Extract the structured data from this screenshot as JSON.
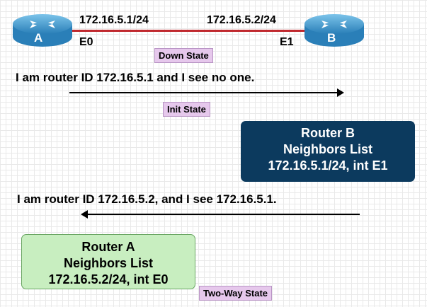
{
  "topology": {
    "router_a": {
      "label": "A",
      "ip": "172.16.5.1/24",
      "interface": "E0"
    },
    "router_b": {
      "label": "B",
      "ip": "172.16.5.2/24",
      "interface": "E1"
    },
    "link_color": "#c0282e"
  },
  "states": {
    "down": "Down State",
    "init": "Init State",
    "two_way": "Two-Way State"
  },
  "messages": {
    "hello_a": "I am router ID 172.16.5.1 and I see  no one.",
    "hello_b": "I am router ID 172.16.5.2, and I see 172.16.5.1."
  },
  "neighbor_lists": {
    "router_b": {
      "title": "Router B",
      "subtitle": "Neighbors List",
      "entry": "172.16.5.1/24, int E1"
    },
    "router_a": {
      "title": "Router A",
      "subtitle": "Neighbors List",
      "entry": "172.16.5.2/24, int E0"
    }
  },
  "colors": {
    "router": "#4aa0d2",
    "neighbors_b": "#0c3a5e",
    "neighbors_a": "#c8eec0",
    "state_badge": "#e6c8ec"
  }
}
